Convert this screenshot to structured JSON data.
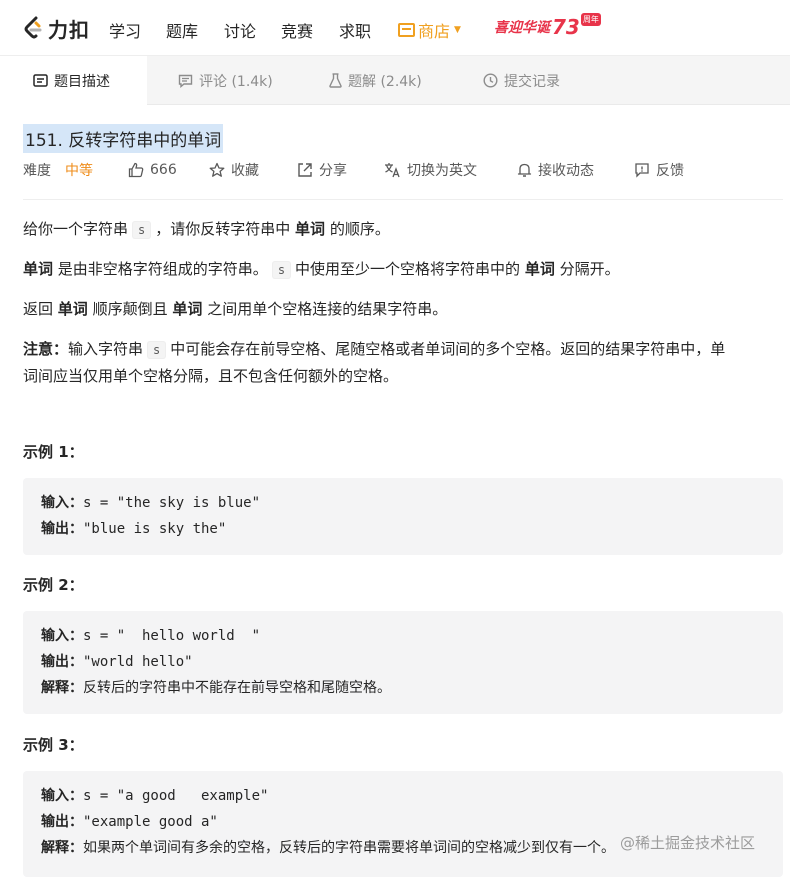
{
  "nav": {
    "logo_text": "力扣",
    "items": [
      "学习",
      "题库",
      "讨论",
      "竞赛",
      "求职"
    ],
    "shop": "商店",
    "promo_text": "喜迎华诞",
    "promo_num": "73",
    "promo_badge": "周年"
  },
  "tabs": [
    {
      "label": "题目描述",
      "active": true
    },
    {
      "label": "评论 (1.4k)"
    },
    {
      "label": "题解 (2.4k)"
    },
    {
      "label": "提交记录"
    }
  ],
  "problem": {
    "title": "151. 反转字符串中的单词",
    "difficulty_label": "难度",
    "difficulty": "中等",
    "likes": "666",
    "collect": "收藏",
    "share": "分享",
    "switch_lang": "切换为英文",
    "subscribe": "接收动态",
    "feedback": "反馈"
  },
  "description": {
    "p1_a": "给你一个字符串",
    "p1_code": "s",
    "p1_b": "，请你反转字符串中",
    "p1_bold": "单词",
    "p1_c": "的顺序。",
    "p2_bold1": "单词",
    "p2_a": "是由非空格字符组成的字符串。",
    "p2_code": "s",
    "p2_b": "中使用至少一个空格将字符串中的",
    "p2_bold2": "单词",
    "p2_c": "分隔开。",
    "p3_a": "返回",
    "p3_bold1": "单词",
    "p3_b": "顺序颠倒且",
    "p3_bold2": "单词",
    "p3_c": "之间用单个空格连接的结果字符串。",
    "note_label": "注意：",
    "note_a": "输入字符串",
    "note_code": "s",
    "note_b": "中可能会存在前导空格、尾随空格或者单词间的多个空格。返回的结果字符串中，单",
    "note_c": "词间应当仅用单个空格分隔，且不包含任何额外的空格。"
  },
  "examples": [
    {
      "title": "示例 1：",
      "input_label": "输入：",
      "input": "s = \"the sky is blue\"",
      "output_label": "输出：",
      "output": "\"blue is sky the\""
    },
    {
      "title": "示例 2：",
      "input_label": "输入：",
      "input": "s = \"  hello world  \"",
      "output_label": "输出：",
      "output": "\"world hello\"",
      "explain_label": "解释：",
      "explain": "反转后的字符串中不能存在前导空格和尾随空格。"
    },
    {
      "title": "示例 3：",
      "input_label": "输入：",
      "input": "s = \"a good   example\"",
      "output_label": "输出：",
      "output": "\"example good a\"",
      "explain_label": "解释：",
      "explain": "如果两个单词间有多余的空格，反转后的字符串需要将单词间的空格减少到仅有一个。"
    }
  ],
  "watermark": "@稀土掘金技术社区",
  "colors": {
    "accent_orange": "#ef8c1a",
    "shop": "#f0a020",
    "promo": "#e8344a",
    "title_highlight": "#d5e6f8"
  }
}
